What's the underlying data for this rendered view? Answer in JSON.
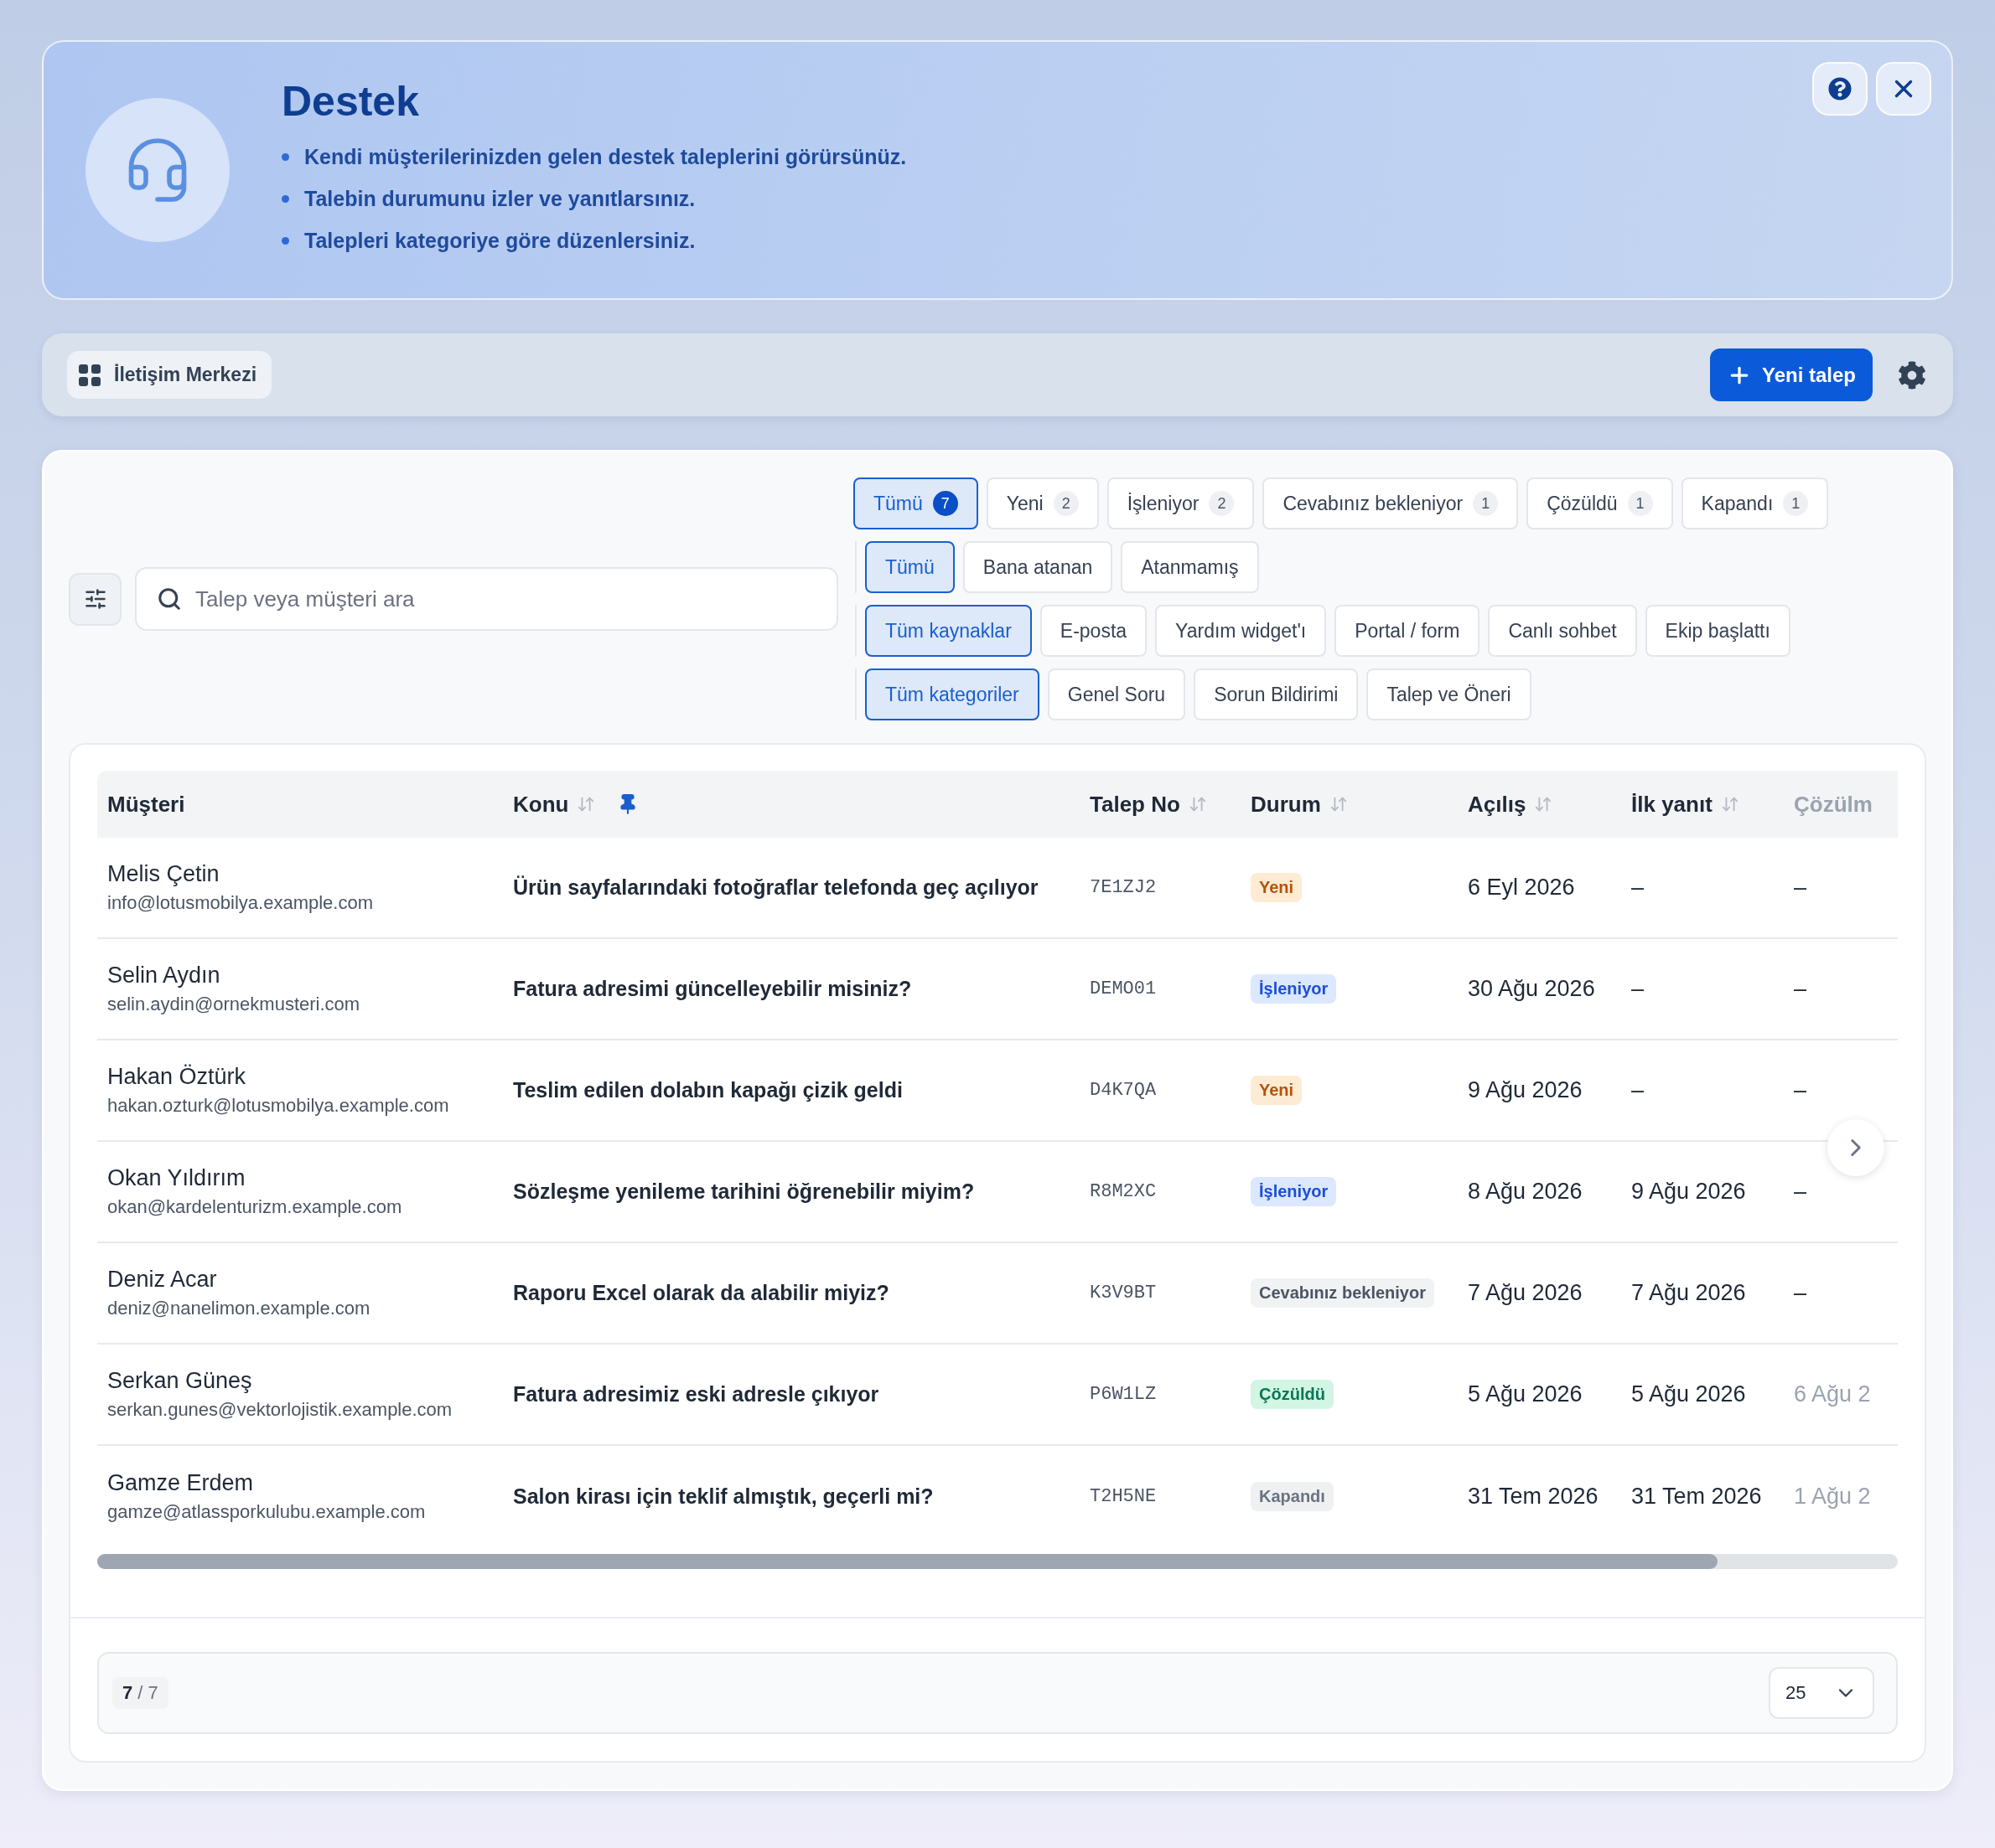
{
  "hero": {
    "title": "Destek",
    "bullets": [
      "Kendi müşterilerinizden gelen destek taleplerini görürsünüz.",
      "Talebin durumunu izler ve yanıtlarsınız.",
      "Talepleri kategoriye göre düzenlersiniz."
    ]
  },
  "toolbar": {
    "module": "İletişim Merkezi",
    "new_button": "Yeni talep"
  },
  "search": {
    "placeholder": "Talep veya müşteri ara"
  },
  "filter_groups": [
    {
      "chips": [
        {
          "label": "Tümü",
          "count": "7",
          "selected": true
        },
        {
          "label": "Yeni",
          "count": "2",
          "selected": false
        },
        {
          "label": "İşleniyor",
          "count": "2",
          "selected": false
        },
        {
          "label": "Cevabınız bekleniyor",
          "count": "1",
          "selected": false
        },
        {
          "label": "Çözüldü",
          "count": "1",
          "selected": false
        },
        {
          "label": "Kapandı",
          "count": "1",
          "selected": false
        }
      ]
    },
    {
      "chips": [
        {
          "label": "Tümü",
          "selected": true
        },
        {
          "label": "Bana atanan",
          "selected": false
        },
        {
          "label": "Atanmamış",
          "selected": false
        }
      ]
    },
    {
      "chips": [
        {
          "label": "Tüm kaynaklar",
          "selected": true
        },
        {
          "label": "E-posta",
          "selected": false
        },
        {
          "label": "Yardım widget'ı",
          "selected": false
        },
        {
          "label": "Portal / form",
          "selected": false
        },
        {
          "label": "Canlı sohbet",
          "selected": false
        },
        {
          "label": "Ekip başlattı",
          "selected": false
        }
      ]
    },
    {
      "chips": [
        {
          "label": "Tüm kategoriler",
          "selected": true
        },
        {
          "label": "Genel Soru",
          "selected": false
        },
        {
          "label": "Sorun Bildirimi",
          "selected": false
        },
        {
          "label": "Talep ve Öneri",
          "selected": false
        }
      ]
    }
  ],
  "table": {
    "columns": [
      {
        "label": "Müşteri",
        "sortable": false,
        "pinned": false
      },
      {
        "label": "Konu",
        "sortable": true,
        "pinned": true
      },
      {
        "label": "Talep No",
        "sortable": true,
        "pinned": false
      },
      {
        "label": "Durum",
        "sortable": true,
        "pinned": false
      },
      {
        "label": "Açılış",
        "sortable": true,
        "pinned": false
      },
      {
        "label": "İlk yanıt",
        "sortable": true,
        "pinned": false
      },
      {
        "label": "Çözülm",
        "sortable": false,
        "pinned": false
      }
    ],
    "rows": [
      {
        "customer": "Melis Çetin",
        "email": "info@lotusmobilya.example.com",
        "subject": "Ürün sayfalarındaki fotoğraflar telefonda geç açılıyor",
        "ticket": "7E1ZJ2",
        "status": {
          "label": "Yeni",
          "kind": "new"
        },
        "opened": "6 Eyl 2026",
        "first_reply": "–",
        "resolved": "–"
      },
      {
        "customer": "Selin Aydın",
        "email": "selin.aydin@ornekmusteri.com",
        "subject": "Fatura adresimi güncelleyebilir misiniz?",
        "ticket": "DEMO01",
        "status": {
          "label": "İşleniyor",
          "kind": "processing"
        },
        "opened": "30 Ağu 2026",
        "first_reply": "–",
        "resolved": "–"
      },
      {
        "customer": "Hakan Öztürk",
        "email": "hakan.ozturk@lotusmobilya.example.com",
        "subject": "Teslim edilen dolabın kapağı çizik geldi",
        "ticket": "D4K7QA",
        "status": {
          "label": "Yeni",
          "kind": "new"
        },
        "opened": "9 Ağu 2026",
        "first_reply": "–",
        "resolved": "–"
      },
      {
        "customer": "Okan Yıldırım",
        "email": "okan@kardelenturizm.example.com",
        "subject": "Sözleşme yenileme tarihini öğrenebilir miyim?",
        "ticket": "R8M2XC",
        "status": {
          "label": "İşleniyor",
          "kind": "processing"
        },
        "opened": "8 Ağu 2026",
        "first_reply": "9 Ağu 2026",
        "resolved": "–"
      },
      {
        "customer": "Deniz Acar",
        "email": "deniz@nanelimon.example.com",
        "subject": "Raporu Excel olarak da alabilir miyiz?",
        "ticket": "K3V9BT",
        "status": {
          "label": "Cevabınız bekleniyor",
          "kind": "waiting"
        },
        "opened": "7 Ağu 2026",
        "first_reply": "7 Ağu 2026",
        "resolved": "–"
      },
      {
        "customer": "Serkan Güneş",
        "email": "serkan.gunes@vektorlojistik.example.com",
        "subject": "Fatura adresimiz eski adresle çıkıyor",
        "ticket": "P6W1LZ",
        "status": {
          "label": "Çözüldü",
          "kind": "resolved"
        },
        "opened": "5 Ağu 2026",
        "first_reply": "5 Ağu 2026",
        "resolved": "6 Ağu 2"
      },
      {
        "customer": "Gamze Erdem",
        "email": "gamze@atlassporkulubu.example.com",
        "subject": "Salon kirası için teklif almıştık, geçerli mi?",
        "ticket": "T2H5NE",
        "status": {
          "label": "Kapandı",
          "kind": "closed"
        },
        "opened": "31 Tem 2026",
        "first_reply": "31 Tem 2026",
        "resolved": "1 Ağu 2"
      }
    ]
  },
  "pagination": {
    "count": "**7** / 7",
    "page_size": "25"
  }
}
